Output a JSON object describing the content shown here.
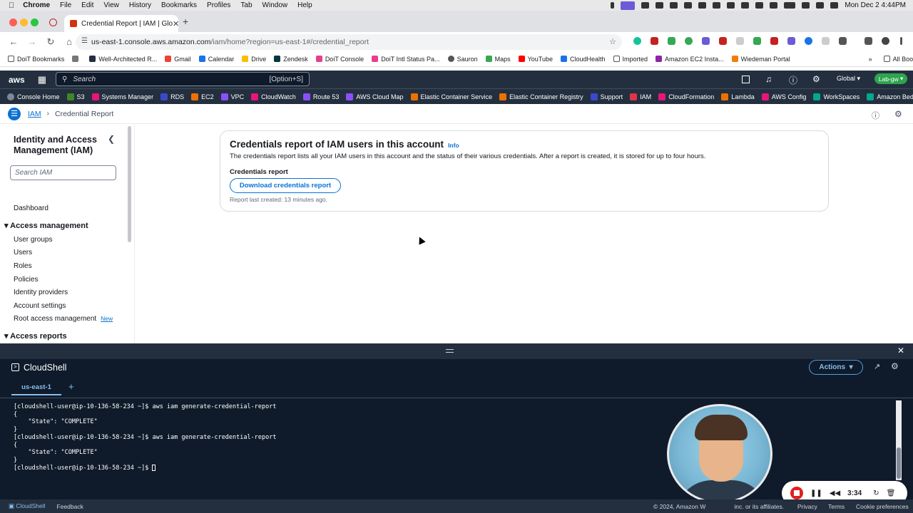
{
  "mac_menubar": {
    "app": "Chrome",
    "menus": [
      "File",
      "Edit",
      "View",
      "History",
      "Bookmarks",
      "Profiles",
      "Tab",
      "Window",
      "Help"
    ],
    "datetime": "Mon Dec 2  4:44PM"
  },
  "browser": {
    "tab_title": "Credential Report | IAM | Glo",
    "url_host": "us-east-1.console.aws.amazon.com",
    "url_path": "/iam/home?region=us-east-1#/credential_report",
    "bookmarks": [
      "DoiT Bookmarks",
      "Well-Architected R...",
      "Gmail",
      "Calendar",
      "Drive",
      "Zendesk",
      "DoiT Console",
      "DoiT Intl Status Pa...",
      "Sauron",
      "Maps",
      "YouTube",
      "CloudHealth",
      "Imported",
      "Amazon EC2 Insta...",
      "Wiedeman Portal"
    ],
    "all_bookmarks": "All Bookmarks"
  },
  "aws_nav": {
    "logo": "aws",
    "search_placeholder": "Search",
    "search_shortcut": "[Option+S]",
    "region": "Global",
    "account": "Lab-gw",
    "favorites": [
      "Console Home",
      "S3",
      "Systems Manager",
      "RDS",
      "EC2",
      "VPC",
      "CloudWatch",
      "Route 53",
      "AWS Cloud Map",
      "Elastic Container Service",
      "Elastic Container Registry",
      "Support",
      "IAM",
      "CloudFormation",
      "Lambda",
      "AWS Config",
      "WorkSpaces",
      "Amazon Bedrock"
    ]
  },
  "breadcrumb": {
    "root": "IAM",
    "current": "Credential Report"
  },
  "sidebar": {
    "title": "Identity and Access Management (IAM)",
    "search_placeholder": "Search IAM",
    "dashboard": "Dashboard",
    "access_management_header": "Access management",
    "items": [
      "User groups",
      "Users",
      "Roles",
      "Policies",
      "Identity providers",
      "Account settings",
      "Root access management"
    ],
    "new_badge": "New",
    "access_reports_header": "Access reports"
  },
  "card": {
    "title": "Credentials report of IAM users in this account",
    "info_link": "Info",
    "description": "The credentials report lists all your IAM users in this account and the status of their various credentials. After a report is created, it is stored for up to four hours.",
    "section_label": "Credentials report",
    "download_button": "Download credentials report",
    "last_created": "Report last created: 13 minutes ago."
  },
  "cloudshell": {
    "title": "CloudShell",
    "actions_label": "Actions",
    "tab_label": "us-east-1",
    "terminal_lines": [
      "[cloudshell-user@ip-10-136-58-234 ~]$ aws iam generate-credential-report",
      "{",
      "    \"State\": \"COMPLETE\"",
      "}",
      "[cloudshell-user@ip-10-136-58-234 ~]$ aws iam generate-credential-report",
      "{",
      "    \"State\": \"COMPLETE\"",
      "}",
      "[cloudshell-user@ip-10-136-58-234 ~]$ "
    ]
  },
  "recorder": {
    "time": "3:34"
  },
  "footer": {
    "cloudshell": "CloudShell",
    "feedback": "Feedback",
    "copyright": "© 2024, Amazon W",
    "copyright_tail": "inc. or its affiliates.",
    "privacy": "Privacy",
    "terms": "Terms",
    "cookie": "Cookie preferences"
  },
  "colors": {
    "aws_nav_bg": "#232f3e",
    "link_blue": "#0972d3",
    "terminal_bg": "#0f1b2a",
    "account_badge": "#2ea44f",
    "record_red": "#e02020"
  }
}
